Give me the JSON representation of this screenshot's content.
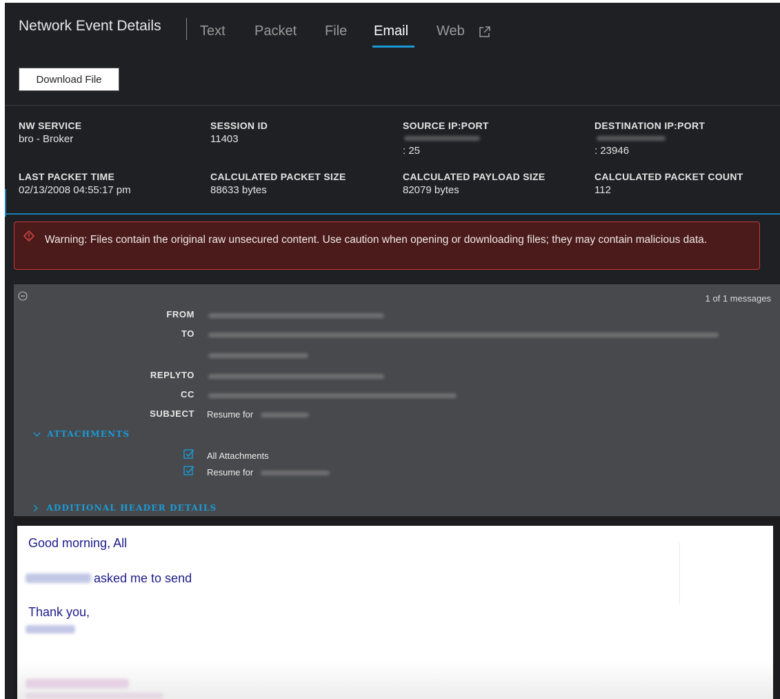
{
  "header": {
    "title": "Network Event Details",
    "tabs": [
      {
        "label": "Text"
      },
      {
        "label": "Packet"
      },
      {
        "label": "File"
      },
      {
        "label": "Email",
        "active": true
      },
      {
        "label": "Web"
      }
    ],
    "download_label": "Download File",
    "accent_color": "#1b9ad6"
  },
  "meta": {
    "nw_service": {
      "label": "NW SERVICE",
      "value": "bro - Broker"
    },
    "session_id": {
      "label": "SESSION ID",
      "value": "11403"
    },
    "source": {
      "label": "SOURCE IP:PORT",
      "value": ": 25"
    },
    "destination": {
      "label": "DESTINATION IP:PORT",
      "value": ": 23946"
    },
    "last_packet_time": {
      "label": "LAST PACKET TIME",
      "value": "02/13/2008 04:55:17 pm"
    },
    "packet_size": {
      "label": "CALCULATED PACKET SIZE",
      "value": "88633 bytes"
    },
    "payload_size": {
      "label": "CALCULATED PAYLOAD SIZE",
      "value": "82079 bytes"
    },
    "packet_count": {
      "label": "CALCULATED PACKET COUNT",
      "value": "112"
    }
  },
  "warning": {
    "text": "Warning: Files contain the original raw unsecured content. Use caution when opening or downloading files; they may contain malicious data.",
    "color": "#c8363a"
  },
  "email": {
    "message_count": "1 of 1 messages",
    "headers": {
      "from_label": "FROM",
      "to_label": "TO",
      "replyto_label": "REPLYTO",
      "cc_label": "CC",
      "subject_label": "SUBJECT",
      "subject_value": "Resume for"
    },
    "attachments_label": "ATTACHMENTS",
    "attachments": [
      {
        "label": "All Attachments",
        "checked": true
      },
      {
        "label": "Resume for",
        "checked": true
      }
    ],
    "additional_label": "ADDITIONAL HEADER DETAILS",
    "body": {
      "greeting": "Good morning, All",
      "line2": "asked me to send",
      "closing": "Thank you,"
    }
  }
}
